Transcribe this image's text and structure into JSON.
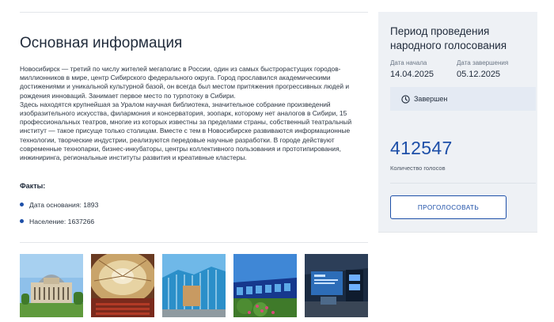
{
  "main": {
    "title": "Основная информация",
    "description": "Новосибирск — третий по числу жителей мегаполис в России, один из самых быстрорастущих городов-миллионников в мире, центр Сибирского федерального округа. Город прославился академическими достижениями и уникальной культурной базой, он всегда был местом притяжения прогрессивных людей и рождения инноваций. Занимает первое место по турпотоку в Сибири.\nЗдесь находятся крупнейшая за Уралом научная библиотека, значительное собрание произведений изобразительного искусства, филармония и консерватория, зоопарк, которому нет аналогов в Сибири, 15 профессиональных театров, многие из которых известны за пределами страны, собственный театральный институт — такое присуще только столицам. Вместе с тем в Новосибирске развиваются информационные технологии, творческие индустрии, реализуются передовые научные разработки. В городе действуют современные технопарки, бизнес-инкубаторы, центры коллективного пользования и прототипирования, инжиниринга, региональные институты развития и креативные кластеры.",
    "facts_title": "Факты:",
    "facts": [
      "Дата основания: 1893",
      "Население: 1637266"
    ]
  },
  "panel": {
    "title": "Период проведения народного голосования",
    "start_label": "Дата начала",
    "start_value": "14.04.2025",
    "end_label": "Дата завершения",
    "end_value": "05.12.2025",
    "status": "Завершен",
    "vote_count": "412547",
    "vote_count_label": "Количество голосов",
    "vote_button": "ПРОГОЛОСОВАТЬ"
  },
  "gallery": {
    "icons": [
      "opera-theatre-photo",
      "theatre-dome-photo",
      "circus-building-photo",
      "museum-building-photo",
      "exhibition-hall-photo"
    ]
  },
  "colors": {
    "accent": "#1d4fa8",
    "panel_bg": "#eef1f5",
    "status_bg": "#e4eaf3"
  }
}
